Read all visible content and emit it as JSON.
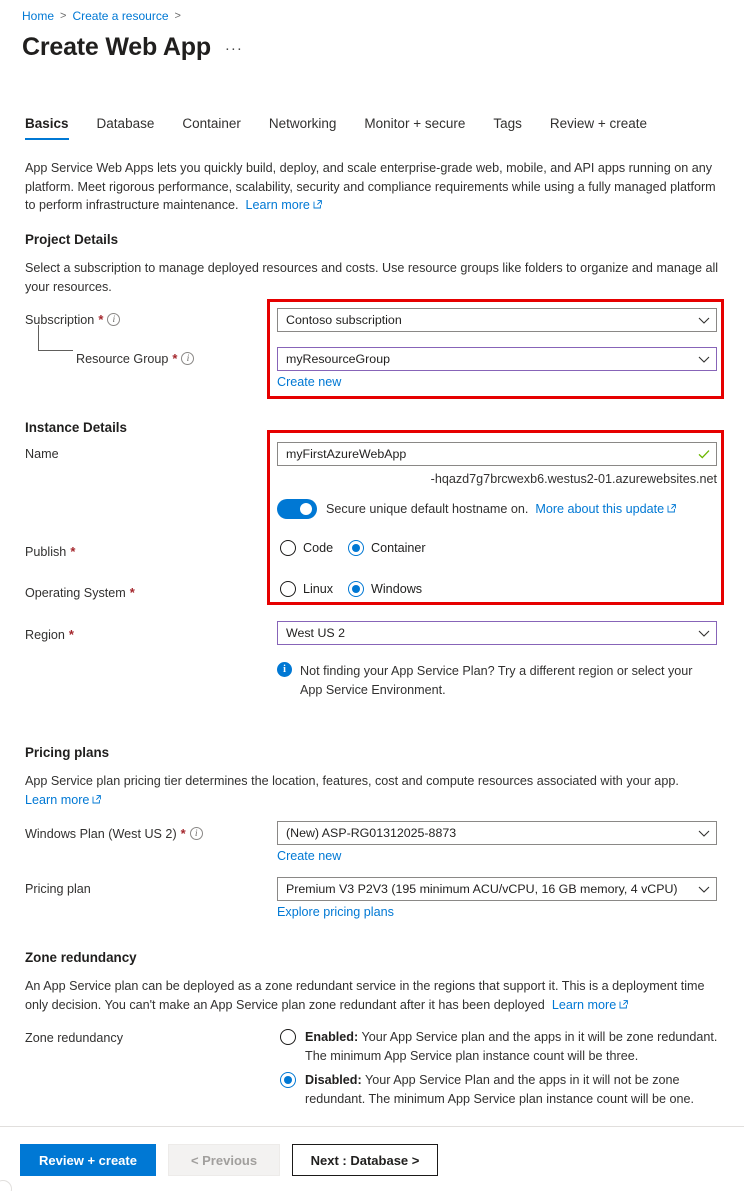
{
  "breadcrumb": {
    "items": [
      "Home",
      "Create a resource"
    ],
    "separator": ">"
  },
  "header": {
    "title": "Create Web App",
    "more_label": "···"
  },
  "tabs": [
    {
      "label": "Basics",
      "active": true
    },
    {
      "label": "Database",
      "active": false
    },
    {
      "label": "Container",
      "active": false
    },
    {
      "label": "Networking",
      "active": false
    },
    {
      "label": "Monitor + secure",
      "active": false
    },
    {
      "label": "Tags",
      "active": false
    },
    {
      "label": "Review + create",
      "active": false
    }
  ],
  "intro": {
    "text": "App Service Web Apps lets you quickly build, deploy, and scale enterprise-grade web, mobile, and API apps running on any platform. Meet rigorous performance, scalability, security and compliance requirements while using a fully managed platform to perform infrastructure maintenance.",
    "learn_more": "Learn more"
  },
  "project_details": {
    "heading": "Project Details",
    "description": "Select a subscription to manage deployed resources and costs. Use resource groups like folders to organize and manage all your resources.",
    "subscription": {
      "label": "Subscription",
      "required": "*",
      "value": "Contoso subscription"
    },
    "resource_group": {
      "label": "Resource Group",
      "required": "*",
      "value": "myResourceGroup",
      "create_new": "Create new"
    }
  },
  "instance_details": {
    "heading": "Instance Details",
    "name": {
      "label": "Name",
      "value": "myFirstAzureWebApp",
      "valid_icon": "checkmark-icon"
    },
    "hostname_suffix": "-hqazd7g7brcwexb6.westus2-01.azurewebsites.net",
    "secure_hostname": {
      "state": "on",
      "text": "Secure unique default hostname on.",
      "link": "More about this update"
    },
    "publish": {
      "label": "Publish",
      "required": "*",
      "options": [
        {
          "label": "Code",
          "selected": false
        },
        {
          "label": "Container",
          "selected": true
        }
      ]
    },
    "operating_system": {
      "label": "Operating System",
      "required": "*",
      "options": [
        {
          "label": "Linux",
          "selected": false
        },
        {
          "label": "Windows",
          "selected": true
        }
      ]
    },
    "region": {
      "label": "Region",
      "required": "*",
      "value": "West US 2",
      "info_message": "Not finding your App Service Plan? Try a different region or select your App Service Environment."
    }
  },
  "pricing_plans": {
    "heading": "Pricing plans",
    "description": "App Service plan pricing tier determines the location, features, cost and compute resources associated with your app.",
    "learn_more": "Learn more",
    "windows_plan": {
      "label": "Windows Plan (West US 2)",
      "required": "*",
      "value": "(New) ASP-RG01312025-8873",
      "create_new": "Create new"
    },
    "pricing_plan": {
      "label": "Pricing plan",
      "value": "Premium V3 P2V3 (195 minimum ACU/vCPU, 16 GB memory, 4 vCPU)",
      "explore": "Explore pricing plans"
    }
  },
  "zone_redundancy": {
    "heading": "Zone redundancy",
    "description": "An App Service plan can be deployed as a zone redundant service in the regions that support it. This is a deployment time only decision. You can't make an App Service plan zone redundant after it has been deployed",
    "learn_more": "Learn more",
    "field_label": "Zone redundancy",
    "options": [
      {
        "title": "Enabled:",
        "text": "Your App Service plan and the apps in it will be zone redundant. The minimum App Service plan instance count will be three.",
        "selected": false
      },
      {
        "title": "Disabled:",
        "text": "Your App Service Plan and the apps in it will not be zone redundant. The minimum App Service plan instance count will be one.",
        "selected": true
      }
    ]
  },
  "footer": {
    "review_create": "Review + create",
    "previous": "< Previous",
    "next": "Next : Database >"
  },
  "colors": {
    "accent": "#0078d4",
    "highlight_box": "#e60000",
    "violet_border": "#8764b8",
    "required_red": "#a4262c",
    "valid_green": "#6bb700"
  }
}
